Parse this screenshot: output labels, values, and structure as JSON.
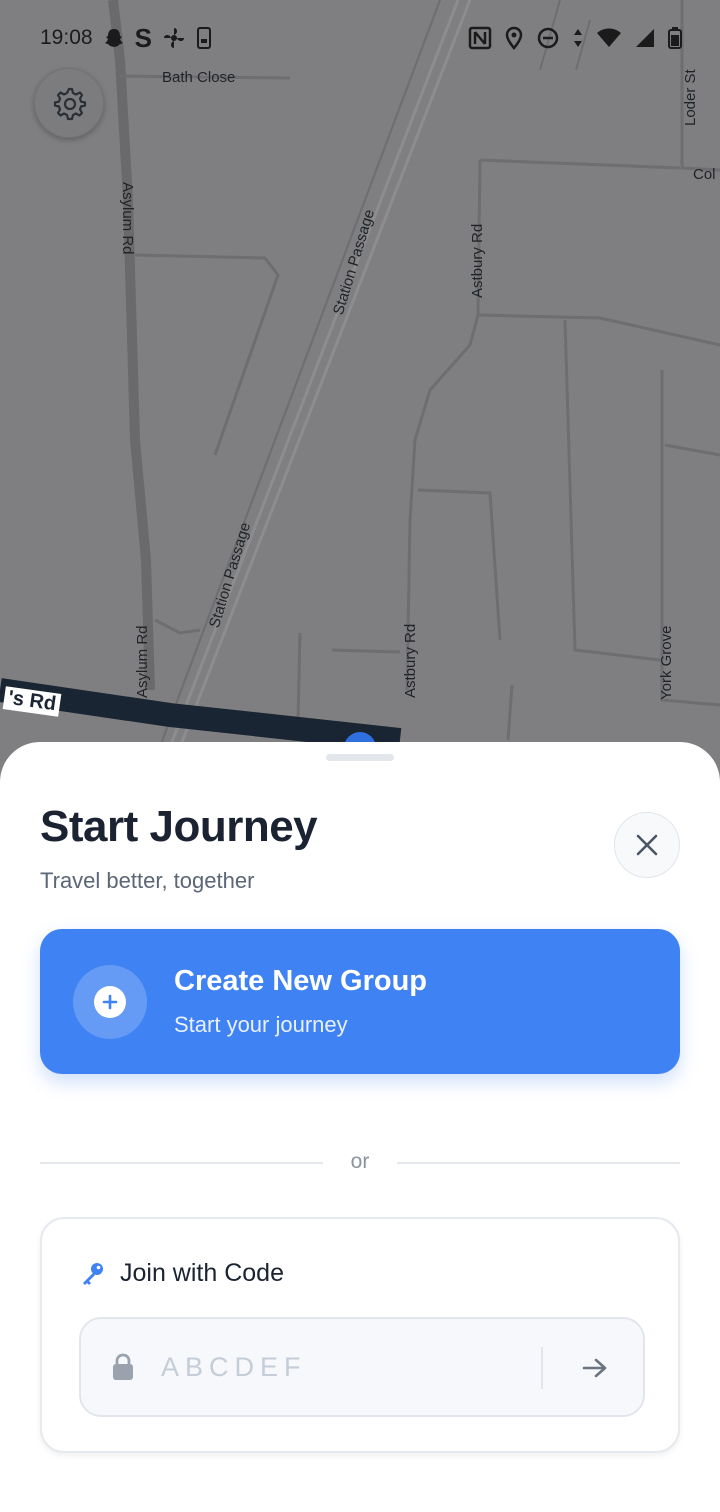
{
  "status_bar": {
    "time": "19:08",
    "icons": [
      "snapchat-icon",
      "s-app-icon",
      "fan-icon",
      "phone-icon",
      "nfc-icon",
      "location-icon",
      "dnd-icon",
      "data-arrows-icon",
      "wifi-icon",
      "signal-icon",
      "battery-icon"
    ]
  },
  "map": {
    "labels": {
      "bath_close": "Bath Close",
      "asylum_rd_top": "Asylum Rd",
      "asylum_rd_bottom": "Asylum Rd",
      "station_passage_top": "Station Passage",
      "station_passage_bottom": "Station Passage",
      "astbury_rd_top": "Astbury Rd",
      "astbury_rd_bottom": "Astbury Rd",
      "loder_st": "Loder St",
      "col": "Col",
      "york_grove": "York Grove",
      "main_rd": "'s Rd"
    }
  },
  "sheet": {
    "title": "Start Journey",
    "subtitle": "Travel better, together",
    "create": {
      "title": "Create New Group",
      "subtitle": "Start your journey"
    },
    "divider_text": "or",
    "join": {
      "title": "Join with Code",
      "placeholder": "ABCDEF",
      "value": ""
    }
  },
  "colors": {
    "primary": "#3f82f3",
    "title": "#1b2333",
    "muted": "#5b6676",
    "map_bg": "#7f7f81"
  }
}
